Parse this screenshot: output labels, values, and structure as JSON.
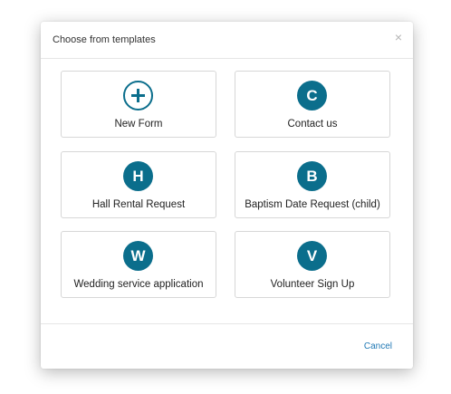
{
  "dialog": {
    "title": "Choose from templates",
    "close_glyph": "×",
    "cancel_label": "Cancel"
  },
  "colors": {
    "accent": "#0b6e8c",
    "link": "#1f78b4"
  },
  "templates": [
    {
      "label": "New Form",
      "badge": "",
      "icon": "plus-icon"
    },
    {
      "label": "Contact us",
      "badge": "C"
    },
    {
      "label": "Hall Rental Request",
      "badge": "H"
    },
    {
      "label": "Baptism Date Request (child)",
      "badge": "B"
    },
    {
      "label": "Wedding service application",
      "badge": "W"
    },
    {
      "label": "Volunteer Sign Up",
      "badge": "V"
    }
  ]
}
